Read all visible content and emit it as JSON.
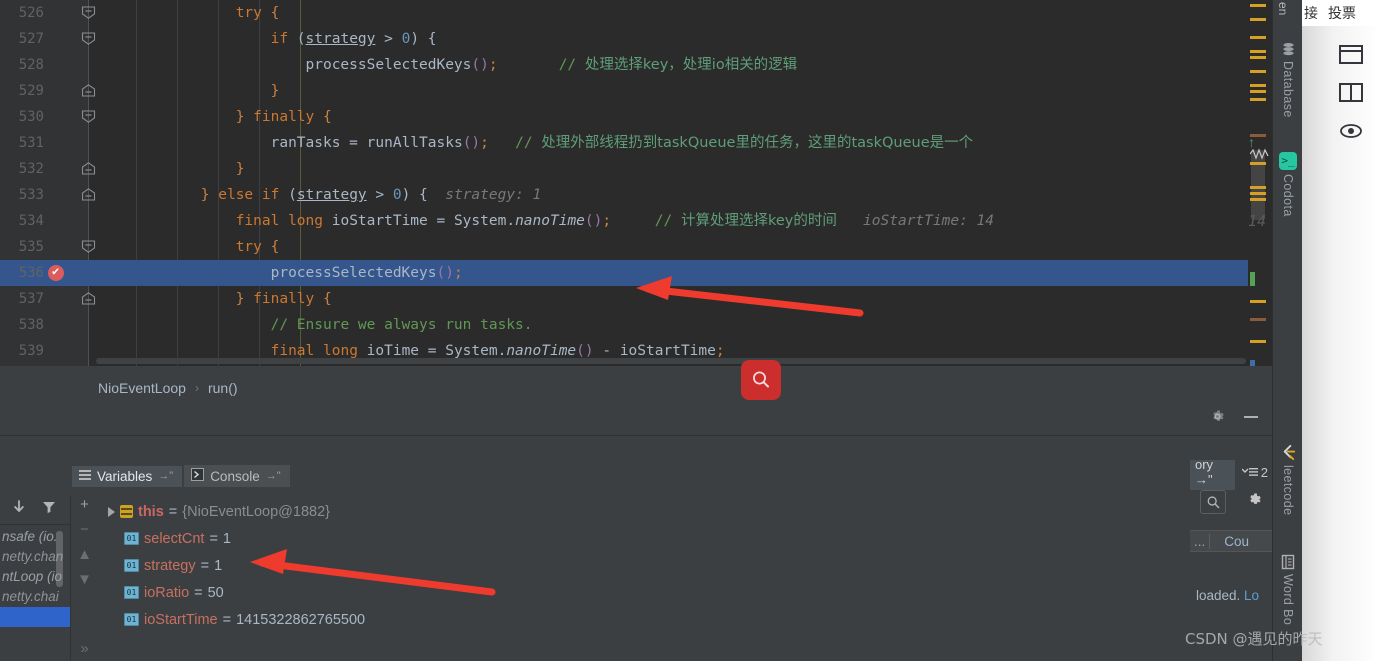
{
  "editor": {
    "lines": [
      {
        "num": "526",
        "fold": "minus-down",
        "indent": 6,
        "segments": [
          {
            "t": "                ",
            "c": "plain"
          },
          {
            "t": "try",
            "c": "kw"
          },
          {
            "t": " {",
            "c": "brc-y"
          }
        ]
      },
      {
        "num": "527",
        "fold": "minus-down",
        "indent": 7,
        "segments": [
          {
            "t": "                    ",
            "c": "plain"
          },
          {
            "t": "if",
            "c": "kw"
          },
          {
            "t": " (",
            "c": "plain"
          },
          {
            "t": "strategy",
            "c": "under"
          },
          {
            "t": " > ",
            "c": "plain"
          },
          {
            "t": "0",
            "c": "num"
          },
          {
            "t": ") {",
            "c": "plain"
          }
        ]
      },
      {
        "num": "528",
        "fold": "",
        "indent": 8,
        "segments": [
          {
            "t": "                        ",
            "c": "plain"
          },
          {
            "t": "processSelectedKeys",
            "c": "plain"
          },
          {
            "t": "()",
            "c": "fld"
          },
          {
            "t": ";",
            "c": "brc-y"
          },
          {
            "t": "       ",
            "c": "plain"
          },
          {
            "t": "// ",
            "c": "cmt"
          },
          {
            "t": "处理选择key，处理io相关的逻辑",
            "c": "cmt-cn"
          }
        ]
      },
      {
        "num": "529",
        "fold": "minus-up",
        "indent": 7,
        "segments": [
          {
            "t": "                    ",
            "c": "plain"
          },
          {
            "t": "}",
            "c": "brc-y"
          }
        ]
      },
      {
        "num": "530",
        "fold": "minus-down",
        "indent": 6,
        "segments": [
          {
            "t": "                ",
            "c": "plain"
          },
          {
            "t": "} ",
            "c": "brc-y"
          },
          {
            "t": "finally",
            "c": "kw"
          },
          {
            "t": " {",
            "c": "brc-y"
          }
        ]
      },
      {
        "num": "531",
        "fold": "",
        "indent": 7,
        "segments": [
          {
            "t": "                    ",
            "c": "plain"
          },
          {
            "t": "ranTasks",
            "c": "plain"
          },
          {
            "t": " = ",
            "c": "plain"
          },
          {
            "t": "runAllTasks",
            "c": "plain"
          },
          {
            "t": "()",
            "c": "fld"
          },
          {
            "t": ";",
            "c": "brc-y"
          },
          {
            "t": "   ",
            "c": "plain"
          },
          {
            "t": "// ",
            "c": "cmt"
          },
          {
            "t": "处理外部线程扔到taskQueue里的任务，这里的taskQueue是一个",
            "c": "cmt-cn"
          }
        ]
      },
      {
        "num": "532",
        "fold": "minus-up",
        "indent": 6,
        "segments": [
          {
            "t": "                ",
            "c": "plain"
          },
          {
            "t": "}",
            "c": "brc-y"
          }
        ]
      },
      {
        "num": "533",
        "fold": "minus-up",
        "indent": 5,
        "segments": [
          {
            "t": "            ",
            "c": "plain"
          },
          {
            "t": "} ",
            "c": "brc-y"
          },
          {
            "t": "else if",
            "c": "kw"
          },
          {
            "t": " (",
            "c": "plain"
          },
          {
            "t": "strategy",
            "c": "under"
          },
          {
            "t": " > ",
            "c": "plain"
          },
          {
            "t": "0",
            "c": "num"
          },
          {
            "t": ") { ",
            "c": "plain"
          },
          {
            "t": " strategy: 1",
            "c": "hint"
          }
        ]
      },
      {
        "num": "534",
        "fold": "",
        "indent": 6,
        "segments": [
          {
            "t": "                ",
            "c": "plain"
          },
          {
            "t": "final",
            "c": "kw"
          },
          {
            "t": " ",
            "c": "plain"
          },
          {
            "t": "long",
            "c": "kw"
          },
          {
            "t": " ioStartTime = System.",
            "c": "plain"
          },
          {
            "t": "nanoTime",
            "c": "ital"
          },
          {
            "t": "()",
            "c": "fld"
          },
          {
            "t": ";",
            "c": "brc-y"
          },
          {
            "t": "     ",
            "c": "plain"
          },
          {
            "t": "// ",
            "c": "cmt"
          },
          {
            "t": "计算处理选择key的时间",
            "c": "cmt-cn"
          },
          {
            "t": "   ioStartTime: 14",
            "c": "hint"
          }
        ]
      },
      {
        "num": "535",
        "fold": "minus-down",
        "indent": 6,
        "segments": [
          {
            "t": "                ",
            "c": "plain"
          },
          {
            "t": "try",
            "c": "kw"
          },
          {
            "t": " {",
            "c": "brc-y"
          }
        ]
      },
      {
        "num": "536",
        "fold": "",
        "highlight": true,
        "breakpoint": true,
        "indent": 7,
        "segments": [
          {
            "t": "                    ",
            "c": "plain"
          },
          {
            "t": "processSelectedKeys",
            "c": "plain"
          },
          {
            "t": "()",
            "c": "fld"
          },
          {
            "t": ";",
            "c": "brc-y"
          }
        ]
      },
      {
        "num": "537",
        "fold": "minus-up",
        "indent": 6,
        "segments": [
          {
            "t": "                ",
            "c": "plain"
          },
          {
            "t": "} ",
            "c": "brc-y"
          },
          {
            "t": "finally",
            "c": "kw"
          },
          {
            "t": " {",
            "c": "brc-y"
          }
        ]
      },
      {
        "num": "538",
        "fold": "",
        "indent": 7,
        "segments": [
          {
            "t": "                    ",
            "c": "plain"
          },
          {
            "t": "// Ensure we always run tasks.",
            "c": "cmt"
          }
        ]
      },
      {
        "num": "539",
        "fold": "",
        "indent": 7,
        "segments": [
          {
            "t": "                    ",
            "c": "plain"
          },
          {
            "t": "final",
            "c": "kw"
          },
          {
            "t": " ",
            "c": "plain"
          },
          {
            "t": "long",
            "c": "kw"
          },
          {
            "t": " ioTime = System.",
            "c": "plain"
          },
          {
            "t": "nanoTime",
            "c": "ital"
          },
          {
            "t": "()",
            "c": "fld"
          },
          {
            "t": " - ioStartTime",
            "c": "plain"
          },
          {
            "t": ";",
            "c": "brc-y"
          }
        ]
      }
    ],
    "marker_hint": "14"
  },
  "breadcrumb": {
    "class_name": "NioEventLoop",
    "separator": "›",
    "method_name": "run()"
  },
  "search_fab": {
    "icon": "search-icon"
  },
  "debug_toolbar": {
    "settings_icon": "gear-icon",
    "minimize_icon": "minimize-icon"
  },
  "debug_tabs": [
    {
      "label": "Variables",
      "pin": "→\"",
      "icon": "variables-icon",
      "active": true
    },
    {
      "label": "Console",
      "pin": "→\"",
      "icon": "console-icon",
      "active": false
    }
  ],
  "variables": [
    {
      "name": "this",
      "value": "{NioEventLoop@1882}",
      "icon": "object-icon",
      "expandable": true,
      "value_style": "obj"
    },
    {
      "name": "selectCnt",
      "value": "1",
      "icon": "field-icon",
      "expandable": false,
      "value_style": "plain"
    },
    {
      "name": "strategy",
      "value": "1",
      "icon": "field-icon",
      "expandable": false,
      "value_style": "plain"
    },
    {
      "name": "ioRatio",
      "value": "50",
      "icon": "field-icon",
      "expandable": false,
      "value_style": "plain"
    },
    {
      "name": "ioStartTime",
      "value": "1415322862765500",
      "icon": "field-icon",
      "expandable": false,
      "value_style": "plain"
    }
  ],
  "var_equals": "=",
  "frames_panel": {
    "toolbar": [
      {
        "icon": "down-arrow-icon"
      },
      {
        "icon": "filter-icon"
      }
    ],
    "items": [
      {
        "label": "nsafe (io."
      },
      {
        "label": "netty.chan"
      },
      {
        "label": "ntLoop (io"
      },
      {
        "label": "netty.chai"
      }
    ],
    "buttons": [
      {
        "icon": "plus-icon",
        "label": "+"
      },
      {
        "icon": "minus-icon",
        "label": "−"
      },
      {
        "icon": "up-arrow-icon",
        "label": "▲"
      },
      {
        "icon": "down-arrow-icon",
        "label": "▼"
      },
      {
        "icon": "expand-icon",
        "label": "»"
      }
    ]
  },
  "side_panel": {
    "tab_label": "ory →\"",
    "tab2_label": "2",
    "search_icon": "search-icon",
    "settings_icon": "gear-icon",
    "col_dots": "...",
    "col_header": "Cou",
    "body_text": "loaded. ",
    "body_link": "Lo"
  },
  "tool_strip": [
    {
      "label": "Database",
      "icon": "database-icon"
    },
    {
      "label": "Codota",
      "icon": "codota-icon"
    },
    {
      "label": "leetcode",
      "icon": "leetcode-icon"
    },
    {
      "label": "Word Bo",
      "icon": "wordbook-icon"
    }
  ],
  "browser": {
    "top_left_fragment": "en",
    "menu_items": [
      "接",
      "投票"
    ],
    "icons": [
      "window-icon",
      "split-view-icon",
      "eye-icon"
    ]
  },
  "watermark": "CSDN @遇见的昨天",
  "colors": {
    "editor_bg": "#2b2b2b",
    "panel_bg": "#3c3f41",
    "gutter_bg": "#313335",
    "highlight_line": "#35568c",
    "comment": "#629755",
    "keyword": "#cc7832",
    "number": "#6897bb",
    "text": "#a9b7c6",
    "breakpoint": "#db5c5c",
    "accent_red": "#cc2d2d",
    "arrow_red": "#ef3b2d",
    "marker_yellow": "#d5a024",
    "codota_green": "#26c6a0"
  }
}
